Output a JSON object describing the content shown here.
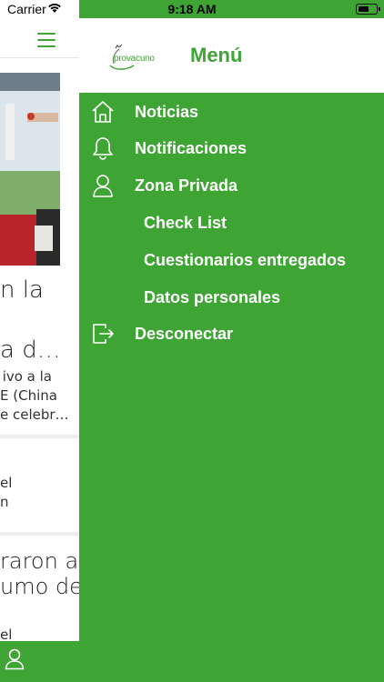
{
  "status_bar": {
    "carrier": "Carrier",
    "time": "9:18 AM"
  },
  "logo_text": "provacuno",
  "menu_title": "Menú",
  "menu_items": [
    {
      "label": "Noticias",
      "icon": "home-icon"
    },
    {
      "label": "Notificaciones",
      "icon": "bell-icon"
    },
    {
      "label": "Zona Privada",
      "icon": "user-icon"
    },
    {
      "label": "Check List"
    },
    {
      "label": "Cuestionarios entregados"
    },
    {
      "label": "Datos personales"
    },
    {
      "label": "Desconectar",
      "icon": "logout-icon"
    }
  ],
  "background_news": {
    "title_line1": "n la",
    "title_line2": "a d…",
    "excerpt_line1": "ivo a la",
    "excerpt_line2": "E (China",
    "excerpt_line3": "e celebr…",
    "item2_line1": "el",
    "item2_line2": "n",
    "item3_line1": "raron a",
    "item3_line2": "umo de",
    "item3_line3": "el"
  },
  "colors": {
    "brand_green": "#3ea535",
    "menu_background": "#3ea535",
    "header_background": "#ffffff",
    "menu_text": "#ffffff"
  }
}
